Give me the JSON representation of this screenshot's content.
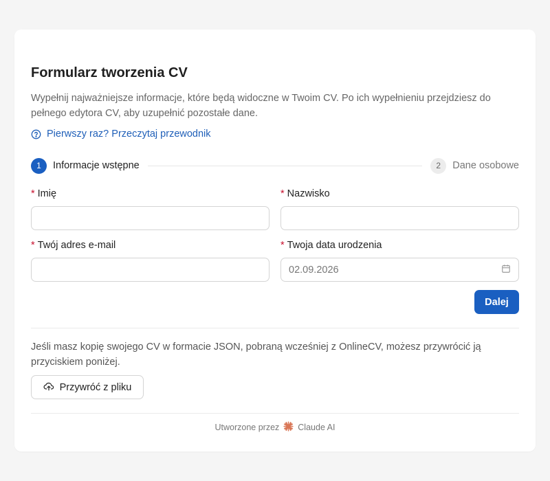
{
  "form": {
    "title": "Formularz tworzenia CV",
    "description": "Wypełnij najważniejsze informacje, które będą widoczne w Twoim CV. Po ich wypełnieniu przejdziesz do pełnego edytora CV, aby uzupełnić pozostałe dane.",
    "guide_link": "Pierwszy raz? Przeczytaj przewodnik"
  },
  "steps": [
    {
      "number": "1",
      "label": "Informacje wstępne"
    },
    {
      "number": "2",
      "label": "Dane osobowe"
    }
  ],
  "fields": {
    "required_mark": "*",
    "first_name": {
      "label": "Imię",
      "value": ""
    },
    "last_name": {
      "label": "Nazwisko",
      "value": ""
    },
    "email": {
      "label": "Twój adres e-mail",
      "value": ""
    },
    "birth_date": {
      "label": "Twoja data urodzenia",
      "value": "02.09.2026"
    }
  },
  "actions": {
    "next_label": "Dalej"
  },
  "restore": {
    "text": "Jeśli masz kopię swojego CV w formacie JSON, pobraną wcześniej z OnlineCV, możesz przywrócić ją przyciskiem poniżej.",
    "button_label": "Przywróć z pliku"
  },
  "footer": {
    "text": "Utworzone przez",
    "brand": "Claude AI"
  },
  "colors": {
    "accent": "#1a5fc1",
    "link": "#1f5fb8",
    "required": "#c8102e",
    "claude_logo": "#d97757"
  },
  "icons": {
    "guide": "question-circle-icon",
    "date": "calendar-icon",
    "restore": "cloud-upload-icon",
    "footer": "claude-logo-icon"
  }
}
